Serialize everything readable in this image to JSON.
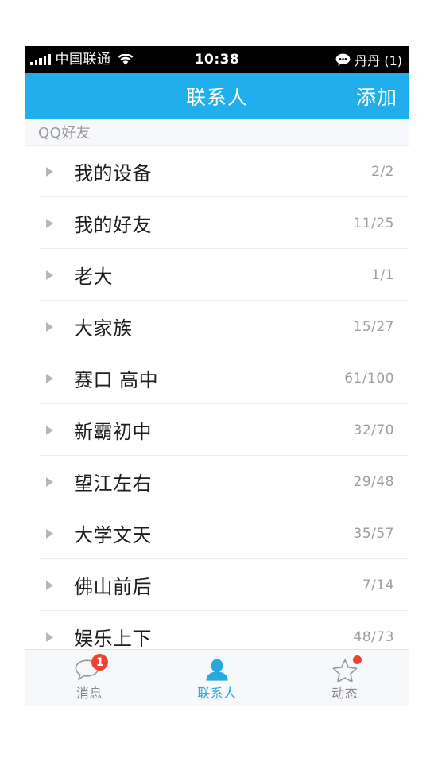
{
  "theme": {
    "accent": "#20aeec",
    "tab_active": "#26a9e0",
    "badge_red": "#ef4136",
    "list_bg": "#ffffff",
    "section_bg": "#f7f8fb",
    "tabbar_bg": "#f7f8fa"
  },
  "status_bar": {
    "signal_icon": "signal-bars-icon",
    "carrier": "中国联通",
    "wifi_icon": "wifi-icon",
    "time": "10:38",
    "message_icon": "speech-bubble-icon",
    "account": "丹丹 (1)"
  },
  "nav": {
    "title": "联系人",
    "action_label": "添加"
  },
  "section": {
    "header": "QQ好友"
  },
  "groups": [
    {
      "name": "我的设备",
      "count": "2/2",
      "disclosure_icon": "triangle-right-icon"
    },
    {
      "name": "我的好友",
      "count": "11/25",
      "disclosure_icon": "triangle-right-icon"
    },
    {
      "name": "老大",
      "count": "1/1",
      "disclosure_icon": "triangle-right-icon"
    },
    {
      "name": "大家族",
      "count": "15/27",
      "disclosure_icon": "triangle-right-icon"
    },
    {
      "name": "赛口 高中",
      "count": "61/100",
      "disclosure_icon": "triangle-right-icon"
    },
    {
      "name": "新霸初中",
      "count": "32/70",
      "disclosure_icon": "triangle-right-icon"
    },
    {
      "name": "望江左右",
      "count": "29/48",
      "disclosure_icon": "triangle-right-icon"
    },
    {
      "name": "大学文天",
      "count": "35/57",
      "disclosure_icon": "triangle-right-icon"
    },
    {
      "name": "佛山前后",
      "count": "7/14",
      "disclosure_icon": "triangle-right-icon"
    },
    {
      "name": "娱乐上下",
      "count": "48/73",
      "disclosure_icon": "triangle-right-icon"
    }
  ],
  "tabs": [
    {
      "label": "消息",
      "icon": "chat-bubble-icon",
      "badge": "1",
      "active": false
    },
    {
      "label": "联系人",
      "icon": "person-icon",
      "badge": "",
      "active": true
    },
    {
      "label": "动态",
      "icon": "star-icon",
      "badge": "dot",
      "active": false
    }
  ]
}
